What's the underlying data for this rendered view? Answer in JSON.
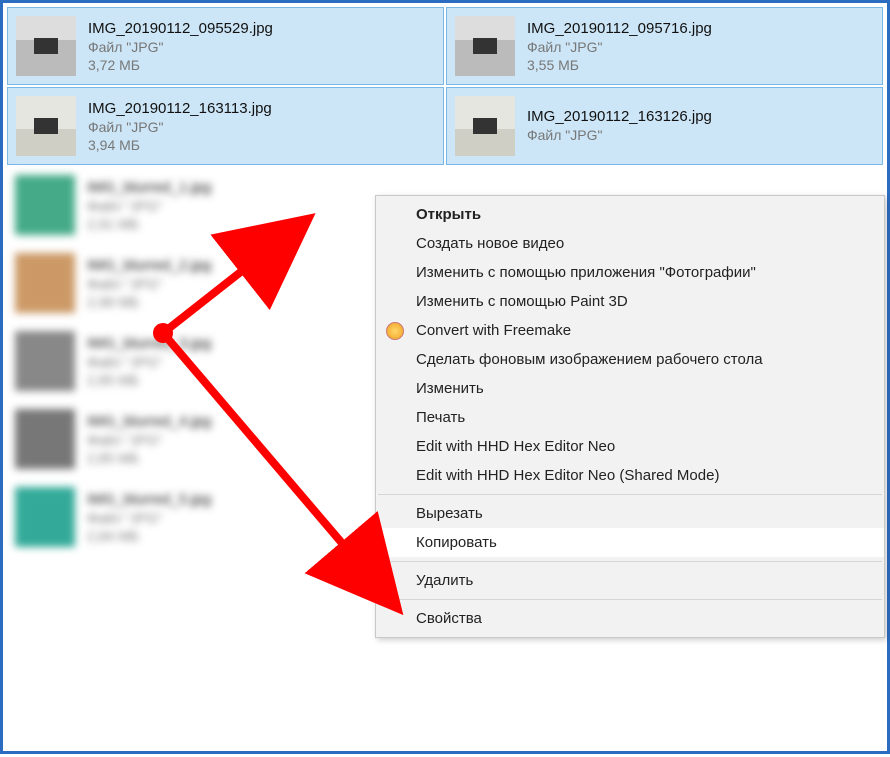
{
  "files": [
    {
      "name": "IMG_20190112_095529.jpg",
      "type": "Файл \"JPG\"",
      "size": "3,72 МБ",
      "selected": true,
      "blurred": false
    },
    {
      "name": "IMG_20190112_095716.jpg",
      "type": "Файл \"JPG\"",
      "size": "3,55 МБ",
      "selected": true,
      "blurred": false
    },
    {
      "name": "IMG_20190112_163113.jpg",
      "type": "Файл \"JPG\"",
      "size": "3,94 МБ",
      "selected": true,
      "blurred": false
    },
    {
      "name": "IMG_20190112_163126.jpg",
      "type": "Файл \"JPG\"",
      "size": "",
      "selected": true,
      "blurred": false
    },
    {
      "name": "IMG_blurred_1.jpg",
      "type": "Файл \"JPG\"",
      "size": "2,91 МБ",
      "selected": false,
      "blurred": true
    },
    {
      "name": "",
      "type": "",
      "size": "",
      "selected": false,
      "blurred": true,
      "hidden": true
    },
    {
      "name": "IMG_blurred_2.jpg",
      "type": "Файл \"JPG\"",
      "size": "2,98 МБ",
      "selected": false,
      "blurred": true
    },
    {
      "name": "",
      "type": "",
      "size": "",
      "selected": false,
      "blurred": true,
      "hidden": true
    },
    {
      "name": "IMG_blurred_3.jpg",
      "type": "Файл \"JPG\"",
      "size": "2,85 МБ",
      "selected": false,
      "blurred": true
    },
    {
      "name": "",
      "type": "",
      "size": "",
      "selected": false,
      "blurred": true,
      "hidden": true
    },
    {
      "name": "IMG_blurred_4.jpg",
      "type": "Файл \"JPG\"",
      "size": "2,85 МБ",
      "selected": false,
      "blurred": true
    },
    {
      "name": "",
      "type": "",
      "size": "",
      "selected": false,
      "blurred": true,
      "hidden": true
    },
    {
      "name": "IMG_blurred_5.jpg",
      "type": "Файл \"JPG\"",
      "size": "2,84 МБ",
      "selected": false,
      "blurred": true
    },
    {
      "name": "",
      "type": "",
      "size": "",
      "selected": false,
      "blurred": true,
      "hidden": true
    }
  ],
  "context_menu": {
    "items": [
      {
        "label": "Открыть",
        "bold": true
      },
      {
        "label": "Создать новое видео"
      },
      {
        "label": "Изменить с помощью приложения \"Фотографии\""
      },
      {
        "label": "Изменить с помощью Paint 3D"
      },
      {
        "label": "Convert with Freemake",
        "icon": "freemake-icon"
      },
      {
        "label": "Сделать фоновым изображением рабочего стола"
      },
      {
        "label": "Изменить"
      },
      {
        "label": "Печать"
      },
      {
        "label": "Edit with HHD Hex Editor Neo"
      },
      {
        "label": "Edit with HHD Hex Editor Neo (Shared Mode)"
      },
      {
        "sep": true
      },
      {
        "label": "Вырезать"
      },
      {
        "label": "Копировать",
        "hover": true
      },
      {
        "sep": true
      },
      {
        "label": "Удалить"
      },
      {
        "sep": true
      },
      {
        "label": "Свойства"
      }
    ]
  }
}
